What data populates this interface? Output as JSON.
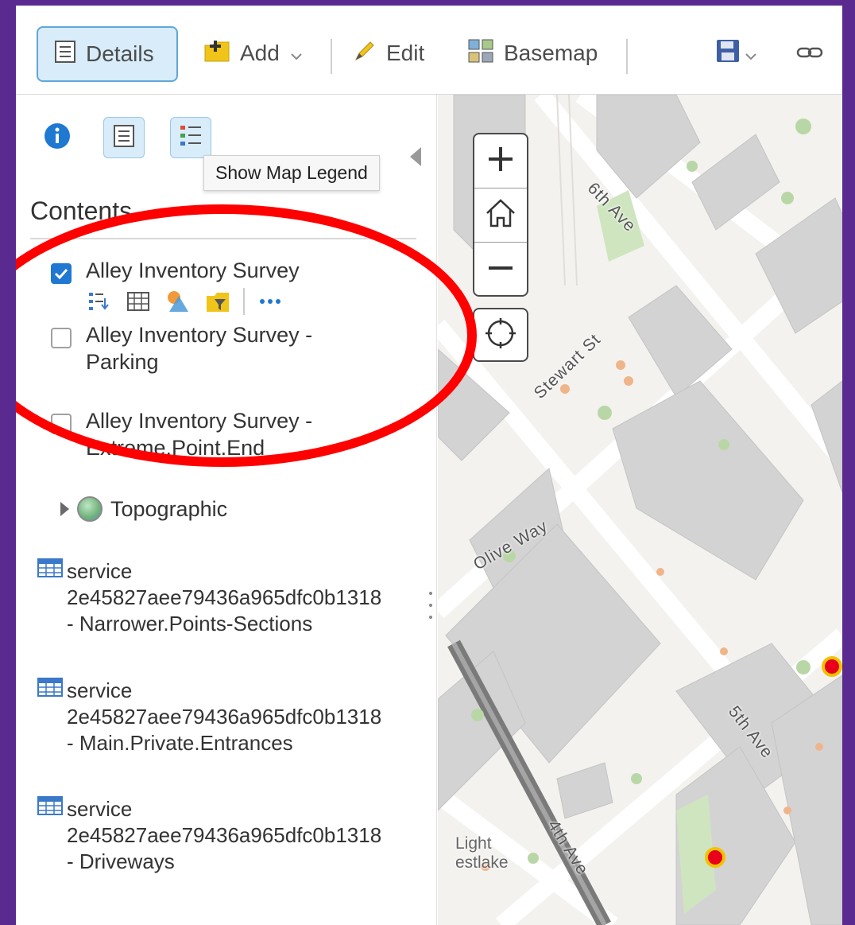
{
  "toolbar": {
    "details_label": "Details",
    "add_label": "Add",
    "edit_label": "Edit",
    "basemap_label": "Basemap"
  },
  "panel": {
    "tooltip": "Show Map Legend",
    "contents_title": "Contents",
    "layers": [
      {
        "name": "Alley Inventory Survey",
        "checked": true
      },
      {
        "name": "Alley Inventory Survey - Parking",
        "name_line1": "Alley Inventory Survey -",
        "name_line2": "Parking",
        "checked": false
      },
      {
        "name": "Alley Inventory Survey - Extreme.Point.End",
        "name_line1": "Alley Inventory Survey -",
        "name_line2": "Extreme.Point.End",
        "checked": false
      }
    ],
    "basemap": "Topographic",
    "services": [
      {
        "line1": "service",
        "line2": "2e45827aee79436a965dfc0b1318",
        "line3": "- Narrower.Points-Sections"
      },
      {
        "line1": "service",
        "line2": "2e45827aee79436a965dfc0b1318",
        "line3": "- Main.Private.Entrances"
      },
      {
        "line1": "service",
        "line2": "2e45827aee79436a965dfc0b1318",
        "line3": "- Driveways"
      }
    ]
  },
  "map": {
    "streets": {
      "sixth": "6th Ave",
      "stewart": "Stewart St",
      "olive": "Olive Way",
      "fifth": "5th Ave",
      "fourth": "4th Ave"
    },
    "place": {
      "line1": "Light",
      "line2": "estlake"
    },
    "point_color": "#e8001c",
    "point_ring": "#f2c200"
  },
  "annotation_color": "#ff0000",
  "accent": "#1f78d1"
}
